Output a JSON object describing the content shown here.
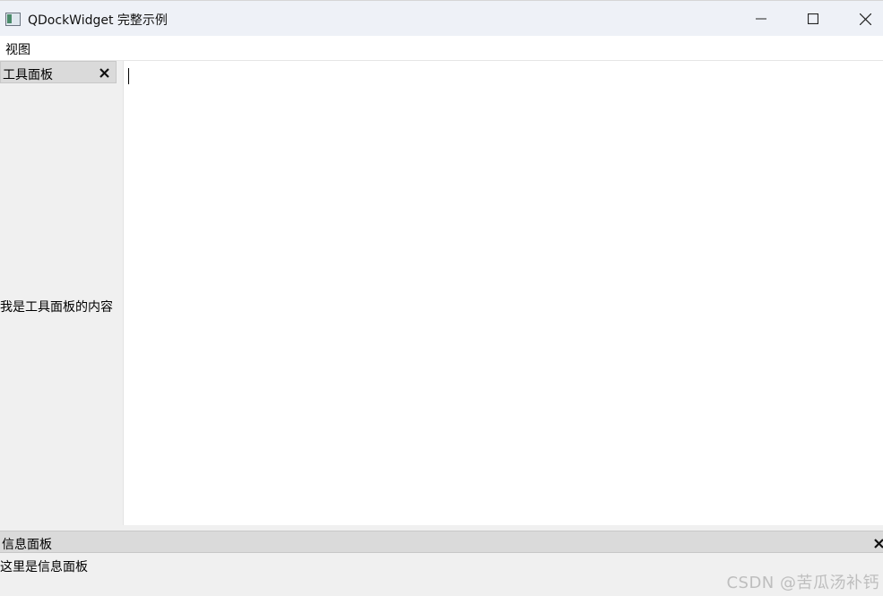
{
  "window": {
    "title": "QDockWidget 完整示例",
    "icon": "qt-window-icon",
    "controls": {
      "minimize_icon": "minimize-icon",
      "maximize_icon": "maximize-icon",
      "close_icon": "close-icon"
    }
  },
  "menubar": {
    "items": [
      {
        "label": "视图"
      }
    ]
  },
  "dock_left": {
    "title": "工具面板",
    "content": "我是工具面板的内容",
    "close_icon": "close-icon"
  },
  "central": {
    "text": ""
  },
  "dock_bottom": {
    "title": "信息面板",
    "content": "这里是信息面板",
    "close_icon": "close-icon"
  },
  "watermark": "CSDN @苦瓜汤补钙",
  "colors": {
    "titlebar_bg": "#eef1f7",
    "dock_title_bg": "#dadada",
    "window_bg": "#f0f0f0",
    "editor_bg": "#ffffff"
  }
}
